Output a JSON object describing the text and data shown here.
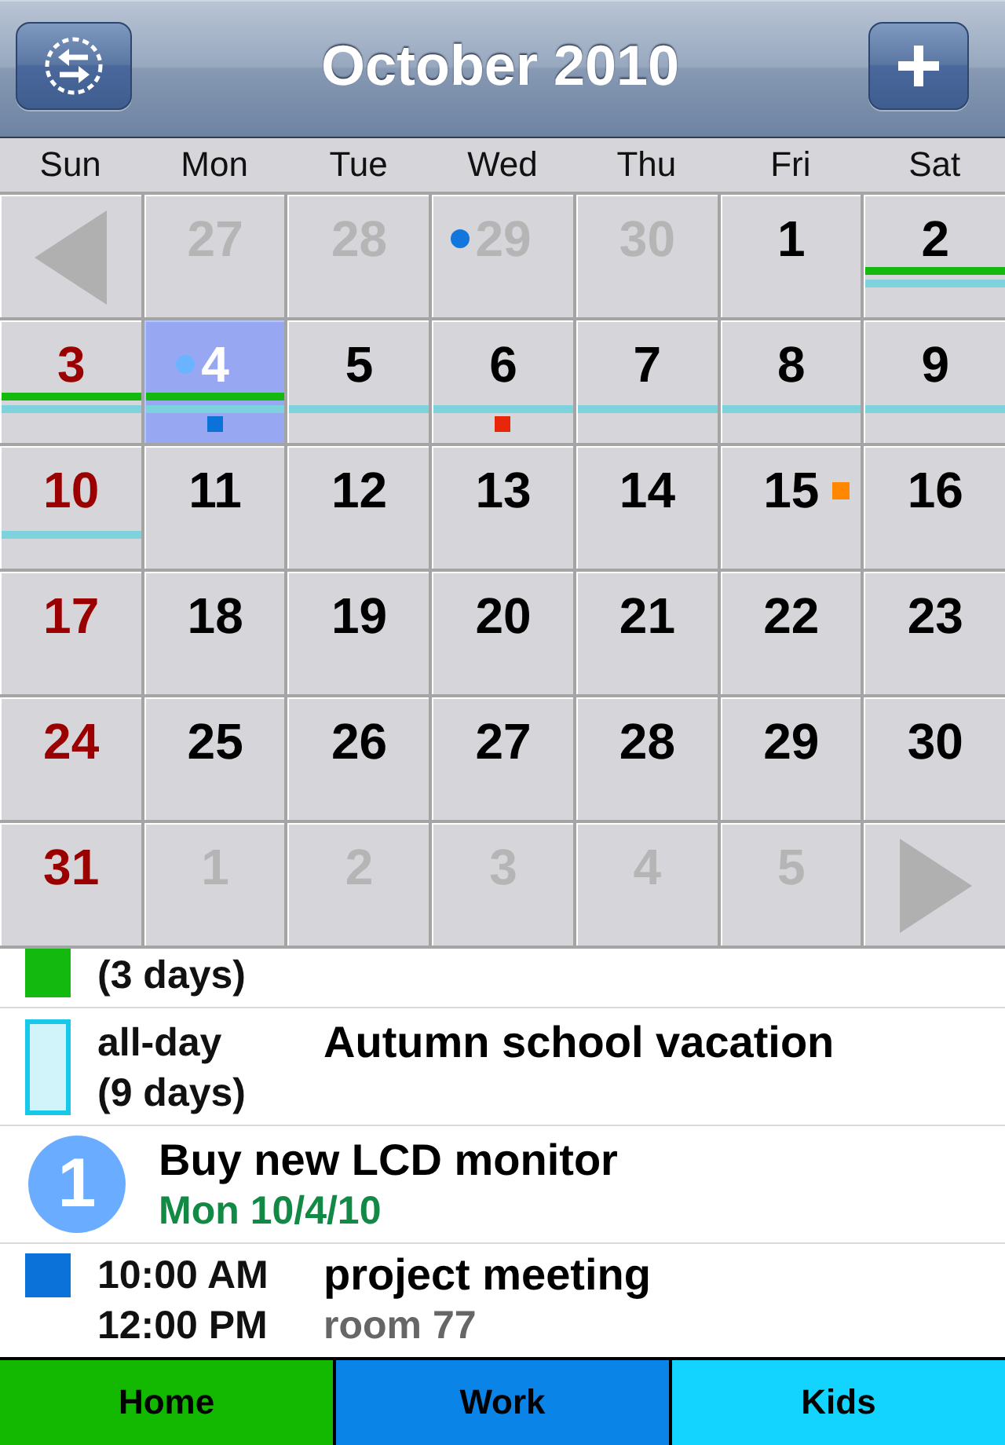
{
  "nav_bar": {
    "title": "October 2010"
  },
  "weekdays": [
    "Sun",
    "Mon",
    "Tue",
    "Wed",
    "Thu",
    "Fri",
    "Sat"
  ],
  "weeks": [
    {
      "days": [
        {
          "kind": "arrow_prev",
          "selected": false
        },
        {
          "kind": "other_month",
          "day": "27",
          "selected": false
        },
        {
          "kind": "other_month",
          "day": "28",
          "selected": false
        },
        {
          "kind": "other_month",
          "day": "29",
          "selected": false,
          "markers": [
            {
              "kind": "dot",
              "color": "#1177dd"
            }
          ]
        },
        {
          "kind": "other_month",
          "day": "30",
          "selected": false
        },
        {
          "kind": "this_month",
          "day": "1",
          "selected": false
        },
        {
          "kind": "this_month",
          "day": "2",
          "selected": false,
          "bars": [
            {
              "kind": "upper",
              "color": "#13b90f"
            },
            {
              "kind": "lower",
              "color": "#7ed2de"
            }
          ]
        }
      ]
    },
    {
      "days": [
        {
          "kind": "this_month",
          "day": "3",
          "selected": false,
          "bars": [
            {
              "kind": "upper",
              "color": "#13b90f"
            },
            {
              "kind": "lower",
              "color": "#7ed2de"
            }
          ]
        },
        {
          "kind": "this_month",
          "day": "4",
          "selected": true,
          "markers": [
            {
              "kind": "dot",
              "color": "#6ab4ff"
            },
            {
              "kind": "square",
              "color": "#0a72d8"
            }
          ],
          "bars": [
            {
              "kind": "upper",
              "color": "#13b90f"
            },
            {
              "kind": "lower",
              "color": "#7ed2de"
            }
          ]
        },
        {
          "kind": "this_month",
          "day": "5",
          "selected": false,
          "bars": [
            {
              "kind": "lower",
              "color": "#7ed2de"
            }
          ]
        },
        {
          "kind": "this_month",
          "day": "6",
          "selected": false,
          "markers": [
            {
              "kind": "square",
              "color": "#e8260a"
            }
          ],
          "bars": [
            {
              "kind": "lower",
              "color": "#7ed2de"
            }
          ]
        },
        {
          "kind": "this_month",
          "day": "7",
          "selected": false,
          "bars": [
            {
              "kind": "lower",
              "color": "#7ed2de"
            }
          ]
        },
        {
          "kind": "this_month",
          "day": "8",
          "selected": false,
          "bars": [
            {
              "kind": "lower",
              "color": "#7ed2de"
            }
          ]
        },
        {
          "kind": "this_month",
          "day": "9",
          "selected": false,
          "bars": [
            {
              "kind": "lower",
              "color": "#7ed2de"
            }
          ]
        }
      ]
    },
    {
      "days": [
        {
          "kind": "this_month",
          "day": "10",
          "selected": false,
          "bars": [
            {
              "kind": "lower",
              "color": "#7ed2de"
            }
          ]
        },
        {
          "kind": "this_month",
          "day": "11",
          "selected": false
        },
        {
          "kind": "this_month",
          "day": "12",
          "selected": false
        },
        {
          "kind": "this_month",
          "day": "13",
          "selected": false
        },
        {
          "kind": "this_month",
          "day": "14",
          "selected": false
        },
        {
          "kind": "this_month",
          "day": "15",
          "selected": false,
          "markers": [
            {
              "kind": "tag",
              "color": "#ff8800"
            }
          ]
        },
        {
          "kind": "this_month",
          "day": "16",
          "selected": false
        }
      ]
    },
    {
      "days": [
        {
          "kind": "this_month",
          "day": "17",
          "selected": false
        },
        {
          "kind": "this_month",
          "day": "18",
          "selected": false
        },
        {
          "kind": "this_month",
          "day": "19",
          "selected": false
        },
        {
          "kind": "this_month",
          "day": "20",
          "selected": false
        },
        {
          "kind": "this_month",
          "day": "21",
          "selected": false
        },
        {
          "kind": "this_month",
          "day": "22",
          "selected": false
        },
        {
          "kind": "this_month",
          "day": "23",
          "selected": false
        }
      ]
    },
    {
      "days": [
        {
          "kind": "this_month",
          "day": "24",
          "selected": false
        },
        {
          "kind": "this_month",
          "day": "25",
          "selected": false
        },
        {
          "kind": "this_month",
          "day": "26",
          "selected": false
        },
        {
          "kind": "this_month",
          "day": "27",
          "selected": false
        },
        {
          "kind": "this_month",
          "day": "28",
          "selected": false
        },
        {
          "kind": "this_month",
          "day": "29",
          "selected": false
        },
        {
          "kind": "this_month",
          "day": "30",
          "selected": false
        }
      ]
    },
    {
      "days": [
        {
          "kind": "this_month",
          "day": "31",
          "selected": false
        },
        {
          "kind": "other_month",
          "day": "1",
          "selected": false
        },
        {
          "kind": "other_month",
          "day": "2",
          "selected": false
        },
        {
          "kind": "other_month",
          "day": "3",
          "selected": false
        },
        {
          "kind": "other_month",
          "day": "4",
          "selected": false
        },
        {
          "kind": "other_month",
          "day": "5",
          "selected": false
        },
        {
          "kind": "arrow_next",
          "selected": false
        }
      ]
    }
  ],
  "agenda": [
    {
      "kind": "allday",
      "color": "#13b90f",
      "outlined": false,
      "duration": "(3 days)"
    },
    {
      "kind": "allday",
      "color": "#18c8e8",
      "outlined": true,
      "time": "all-day",
      "duration": "(9 days)",
      "title": "Autumn school vacation"
    },
    {
      "kind": "task",
      "color": "#6aacff",
      "number": "1",
      "title": "Buy new LCD monitor",
      "due": "Mon 10/4/10"
    },
    {
      "kind": "timed",
      "color": "#0a72d8",
      "outlined": false,
      "start": "10:00 AM",
      "end": "12:00 PM",
      "title": "project meeting",
      "location": "room 77"
    }
  ],
  "calendars": [
    {
      "label": "Home",
      "color": "#12b900"
    },
    {
      "label": "Work",
      "color": "#0a84e6"
    },
    {
      "label": "Kids",
      "color": "#12d4ff"
    }
  ]
}
